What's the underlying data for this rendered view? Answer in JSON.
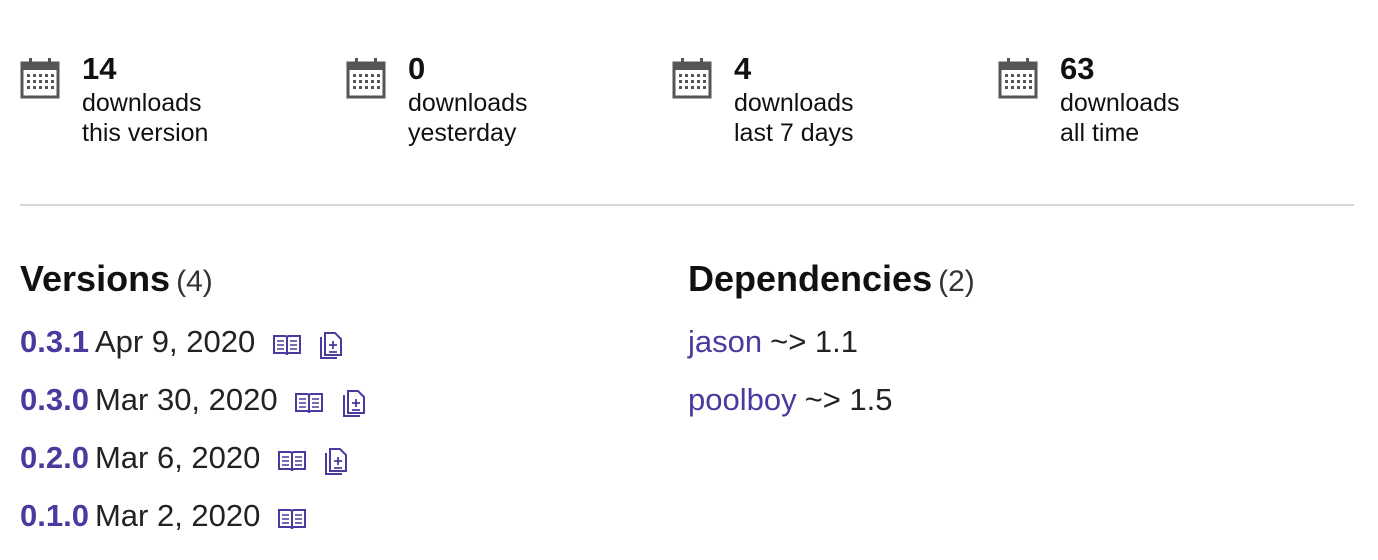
{
  "stats": [
    {
      "value": "14",
      "label1": "downloads",
      "label2": "this version",
      "icon": "calendar-icon"
    },
    {
      "value": "0",
      "label1": "downloads",
      "label2": "yesterday",
      "icon": "calendar-icon"
    },
    {
      "value": "4",
      "label1": "downloads",
      "label2": "last 7 days",
      "icon": "calendar-icon"
    },
    {
      "value": "63",
      "label1": "downloads",
      "label2": "all time",
      "icon": "calendar-icon"
    }
  ],
  "versions": {
    "title": "Versions",
    "count": "(4)",
    "items": [
      {
        "version": "0.3.1",
        "date": "Apr 9, 2020",
        "has_docs": true,
        "has_diff": true
      },
      {
        "version": "0.3.0",
        "date": "Mar 30, 2020",
        "has_docs": true,
        "has_diff": true
      },
      {
        "version": "0.2.0",
        "date": "Mar 6, 2020",
        "has_docs": true,
        "has_diff": true
      },
      {
        "version": "0.1.0",
        "date": "Mar 2, 2020",
        "has_docs": true,
        "has_diff": false
      }
    ]
  },
  "dependencies": {
    "title": "Dependencies",
    "count": "(2)",
    "items": [
      {
        "name": "jason",
        "requirement": "~> 1.1"
      },
      {
        "name": "poolboy",
        "requirement": "~> 1.5"
      }
    ]
  },
  "colors": {
    "link": "#4b3a9e",
    "text": "#111111",
    "divider": "#d6d6d6",
    "icon_gray": "#555555"
  }
}
